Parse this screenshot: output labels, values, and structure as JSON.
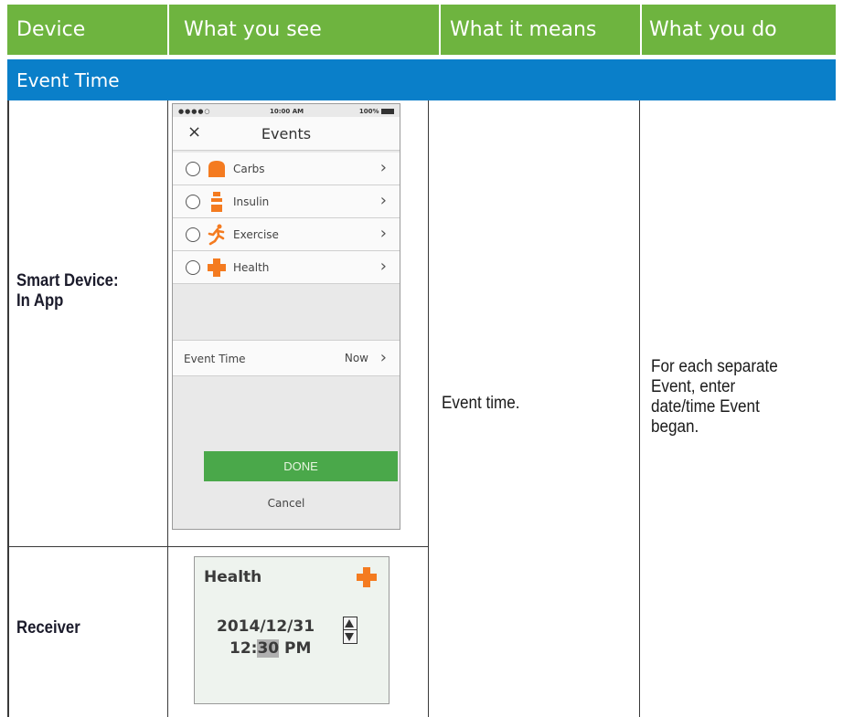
{
  "header": {
    "col1": "Device",
    "col2": "What you see",
    "col3": "What it means",
    "col4": "What you do"
  },
  "section_title": "Event Time",
  "rows": {
    "smart_device_label_line1": "Smart Device:",
    "smart_device_label_line2": "In App",
    "receiver_label": "Receiver"
  },
  "meaning": "Event time.",
  "action_lines": [
    "For each separate",
    "Event, enter",
    "date/time Event",
    "began."
  ],
  "phone": {
    "status_time": "10:00 AM",
    "status_battery": "100%",
    "close_symbol": "×",
    "title": "Events",
    "items": [
      {
        "label": "Carbs",
        "icon": "carbs-icon"
      },
      {
        "label": "Insulin",
        "icon": "insulin-icon"
      },
      {
        "label": "Exercise",
        "icon": "exercise-icon"
      },
      {
        "label": "Health",
        "icon": "health-icon"
      }
    ],
    "chevron": "›",
    "event_time_label": "Event Time",
    "event_time_value": "Now",
    "done_label": "DONE",
    "cancel_label": "Cancel"
  },
  "receiver": {
    "title": "Health",
    "date": "2014/12/31",
    "time_hour": "12:",
    "time_minutes": "30",
    "time_ampm": " PM"
  },
  "colors": {
    "header_green": "#6eb43f",
    "section_blue": "#0a7fc9",
    "icon_orange": "#f47b20",
    "done_green": "#4aa84a"
  }
}
